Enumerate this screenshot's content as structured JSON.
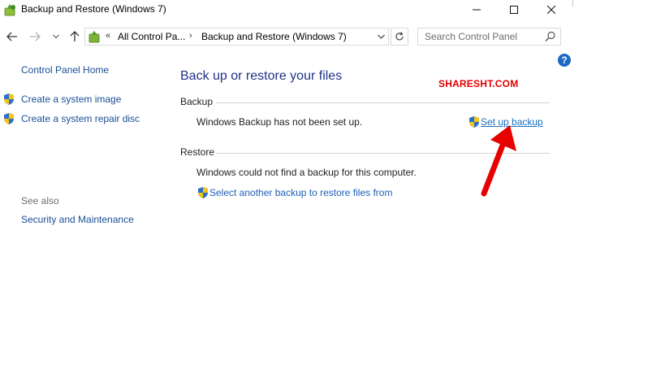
{
  "window": {
    "title": "Backup and Restore (Windows 7)"
  },
  "address_bar": {
    "overflow_chevron": "«",
    "segments": [
      "All Control Pa...",
      "Backup and Restore (Windows 7)"
    ],
    "separator": "›"
  },
  "search": {
    "placeholder": "Search Control Panel"
  },
  "sidebar": {
    "home": "Control Panel Home",
    "tasks": [
      "Create a system image",
      "Create a system repair disc"
    ],
    "see_also_label": "See also",
    "see_also_links": [
      "Security and Maintenance"
    ]
  },
  "main": {
    "title": "Back up or restore your files",
    "backup": {
      "heading": "Backup",
      "status": "Windows Backup has not been set up.",
      "action_link": "Set up backup"
    },
    "restore": {
      "heading": "Restore",
      "status": "Windows could not find a backup for this computer.",
      "action_link": "Select another backup to restore files from"
    }
  },
  "watermark": "SHARESHT.COM",
  "help_glyph": "?",
  "colors": {
    "title_blue": "#1e3287",
    "link_blue": "#1a4e96",
    "annotation_red": "#e00000",
    "help_blue": "#1e68c5"
  }
}
